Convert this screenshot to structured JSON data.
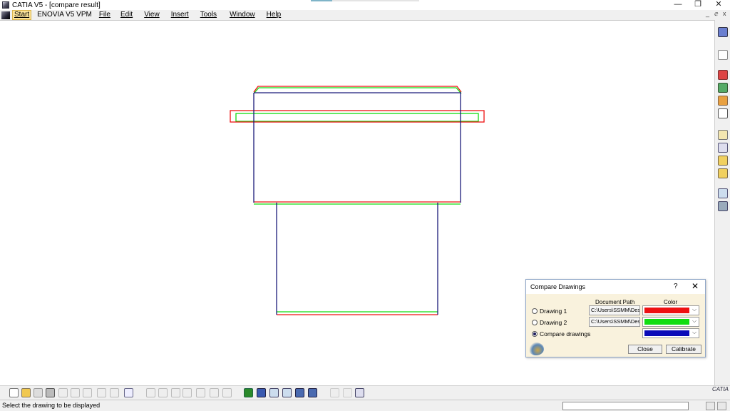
{
  "window": {
    "title": "CATIA V5 - [compare result]",
    "minimize": "—",
    "restore": "❐",
    "close": "✕"
  },
  "menubar": {
    "items": [
      "Start",
      "ENOVIA V5 VPM",
      "File",
      "Edit",
      "View",
      "Insert",
      "Tools",
      "Window",
      "Help"
    ],
    "doc_minimize": "_",
    "doc_restore": "ⅇ",
    "doc_close": "x"
  },
  "colors": {
    "drawing1": "#ee1111",
    "drawing2": "#11dd11",
    "compare": "#0a0ab8",
    "outline": "#1a1a7a"
  },
  "dialog": {
    "title": "Compare Drawings",
    "help": "?",
    "close": "✕",
    "col_path": "Document Path",
    "col_color": "Color",
    "rows": [
      {
        "label": "Drawing 1",
        "path": "C:\\Users\\SSMM\\Des",
        "color": "#ee1111",
        "selected": false
      },
      {
        "label": "Drawing 2",
        "path": "C:\\Users\\SSMM\\Des",
        "color": "#11dd11",
        "selected": false
      },
      {
        "label": "Compare drawings",
        "path": "",
        "color": "#0a0ab8",
        "selected": true
      }
    ],
    "close_button": "Close",
    "calibrate_button": "Calibrate"
  },
  "status": {
    "message": "Select the drawing to be displayed"
  },
  "branding": {
    "logo_text": "CATIA"
  }
}
